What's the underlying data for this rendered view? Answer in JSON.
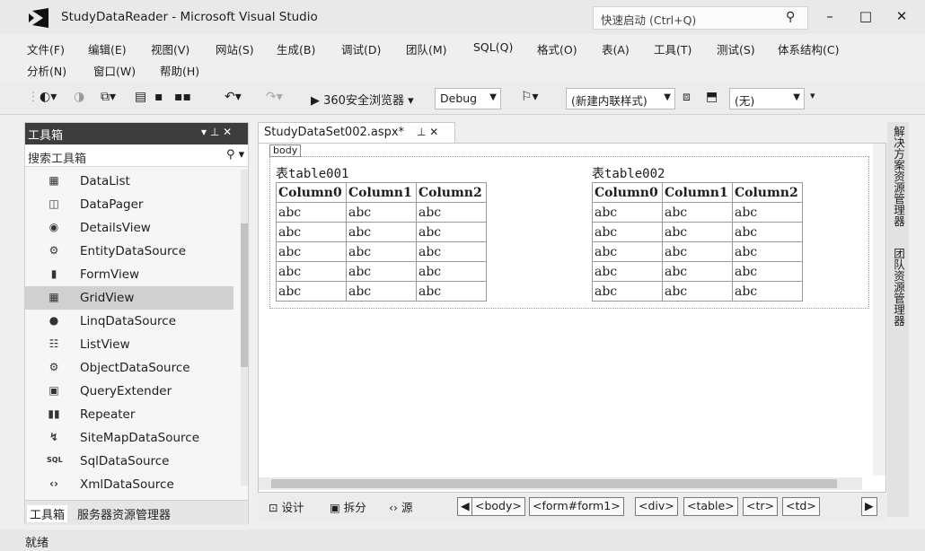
{
  "titlebar": {
    "title": "StudyDataReader - Microsoft Visual Studio",
    "quick_launch_placeholder": "快速启动 (Ctrl+Q)",
    "search_icon": "search-icon",
    "minimize": "–",
    "maximize": "□",
    "close": "✕"
  },
  "menu": {
    "row1": [
      "文件(F)",
      "编辑(E)",
      "视图(V)",
      "网站(S)",
      "生成(B)",
      "调试(D)",
      "团队(M)",
      "SQL(Q)",
      "格式(O)",
      "表(A)",
      "工具(T)",
      "测试(S)",
      "体系结构(C)"
    ],
    "row2": [
      "分析(N)",
      "窗口(W)",
      "帮助(H)"
    ]
  },
  "toolbar": {
    "run_label": "▶ 360安全浏览器 ▾",
    "config_value": "Debug",
    "style_value": "(新建内联样式)",
    "target_value": "(无)"
  },
  "toolbox": {
    "title": "工具箱",
    "header_controls": "▾ ⊥ ✕",
    "search_placeholder": "搜索工具箱",
    "search_icon_glyph": "⚲ ▾",
    "items": [
      {
        "label": "DataList",
        "icon": "▦"
      },
      {
        "label": "DataPager",
        "icon": "◫"
      },
      {
        "label": "DetailsView",
        "icon": "◉"
      },
      {
        "label": "EntityDataSource",
        "icon": "⚙"
      },
      {
        "label": "FormView",
        "icon": "▮"
      },
      {
        "label": "GridView",
        "icon": "▦"
      },
      {
        "label": "LinqDataSource",
        "icon": "●"
      },
      {
        "label": "ListView",
        "icon": "☷"
      },
      {
        "label": "ObjectDataSource",
        "icon": "⚙"
      },
      {
        "label": "QueryExtender",
        "icon": "▣"
      },
      {
        "label": "Repeater",
        "icon": "▮▮"
      },
      {
        "label": "SiteMapDataSource",
        "icon": "↯"
      },
      {
        "label": "SqlDataSource",
        "icon": "SQL"
      },
      {
        "label": "XmlDataSource",
        "icon": "‹›"
      }
    ],
    "selected_index": 5,
    "tabs": [
      "工具箱",
      "服务器资源管理器"
    ]
  },
  "editor": {
    "tab_label": "StudyDataSet002.aspx*",
    "tab_controls": "⊥ ✕",
    "body_tag": "body",
    "tables": [
      {
        "title": "表table001",
        "headers": [
          "Column0",
          "Column1",
          "Column2"
        ],
        "rows": [
          [
            "abc",
            "abc",
            "abc"
          ],
          [
            "abc",
            "abc",
            "abc"
          ],
          [
            "abc",
            "abc",
            "abc"
          ],
          [
            "abc",
            "abc",
            "abc"
          ],
          [
            "abc",
            "abc",
            "abc"
          ]
        ]
      },
      {
        "title": "表table002",
        "headers": [
          "Column0",
          "Column1",
          "Column2"
        ],
        "rows": [
          [
            "abc",
            "abc",
            "abc"
          ],
          [
            "abc",
            "abc",
            "abc"
          ],
          [
            "abc",
            "abc",
            "abc"
          ],
          [
            "abc",
            "abc",
            "abc"
          ],
          [
            "abc",
            "abc",
            "abc"
          ]
        ]
      }
    ]
  },
  "view_buttons": {
    "design": "⊡ 设计",
    "split": "▣ 拆分",
    "source": "‹› 源"
  },
  "breadcrumbs": [
    "<body>",
    "<form#form1>",
    "<div>",
    "<table>",
    "<tr>",
    "<td>"
  ],
  "right_tabs": [
    "解决方案资源管理器",
    "团队资源管理器"
  ],
  "status": "就绪"
}
